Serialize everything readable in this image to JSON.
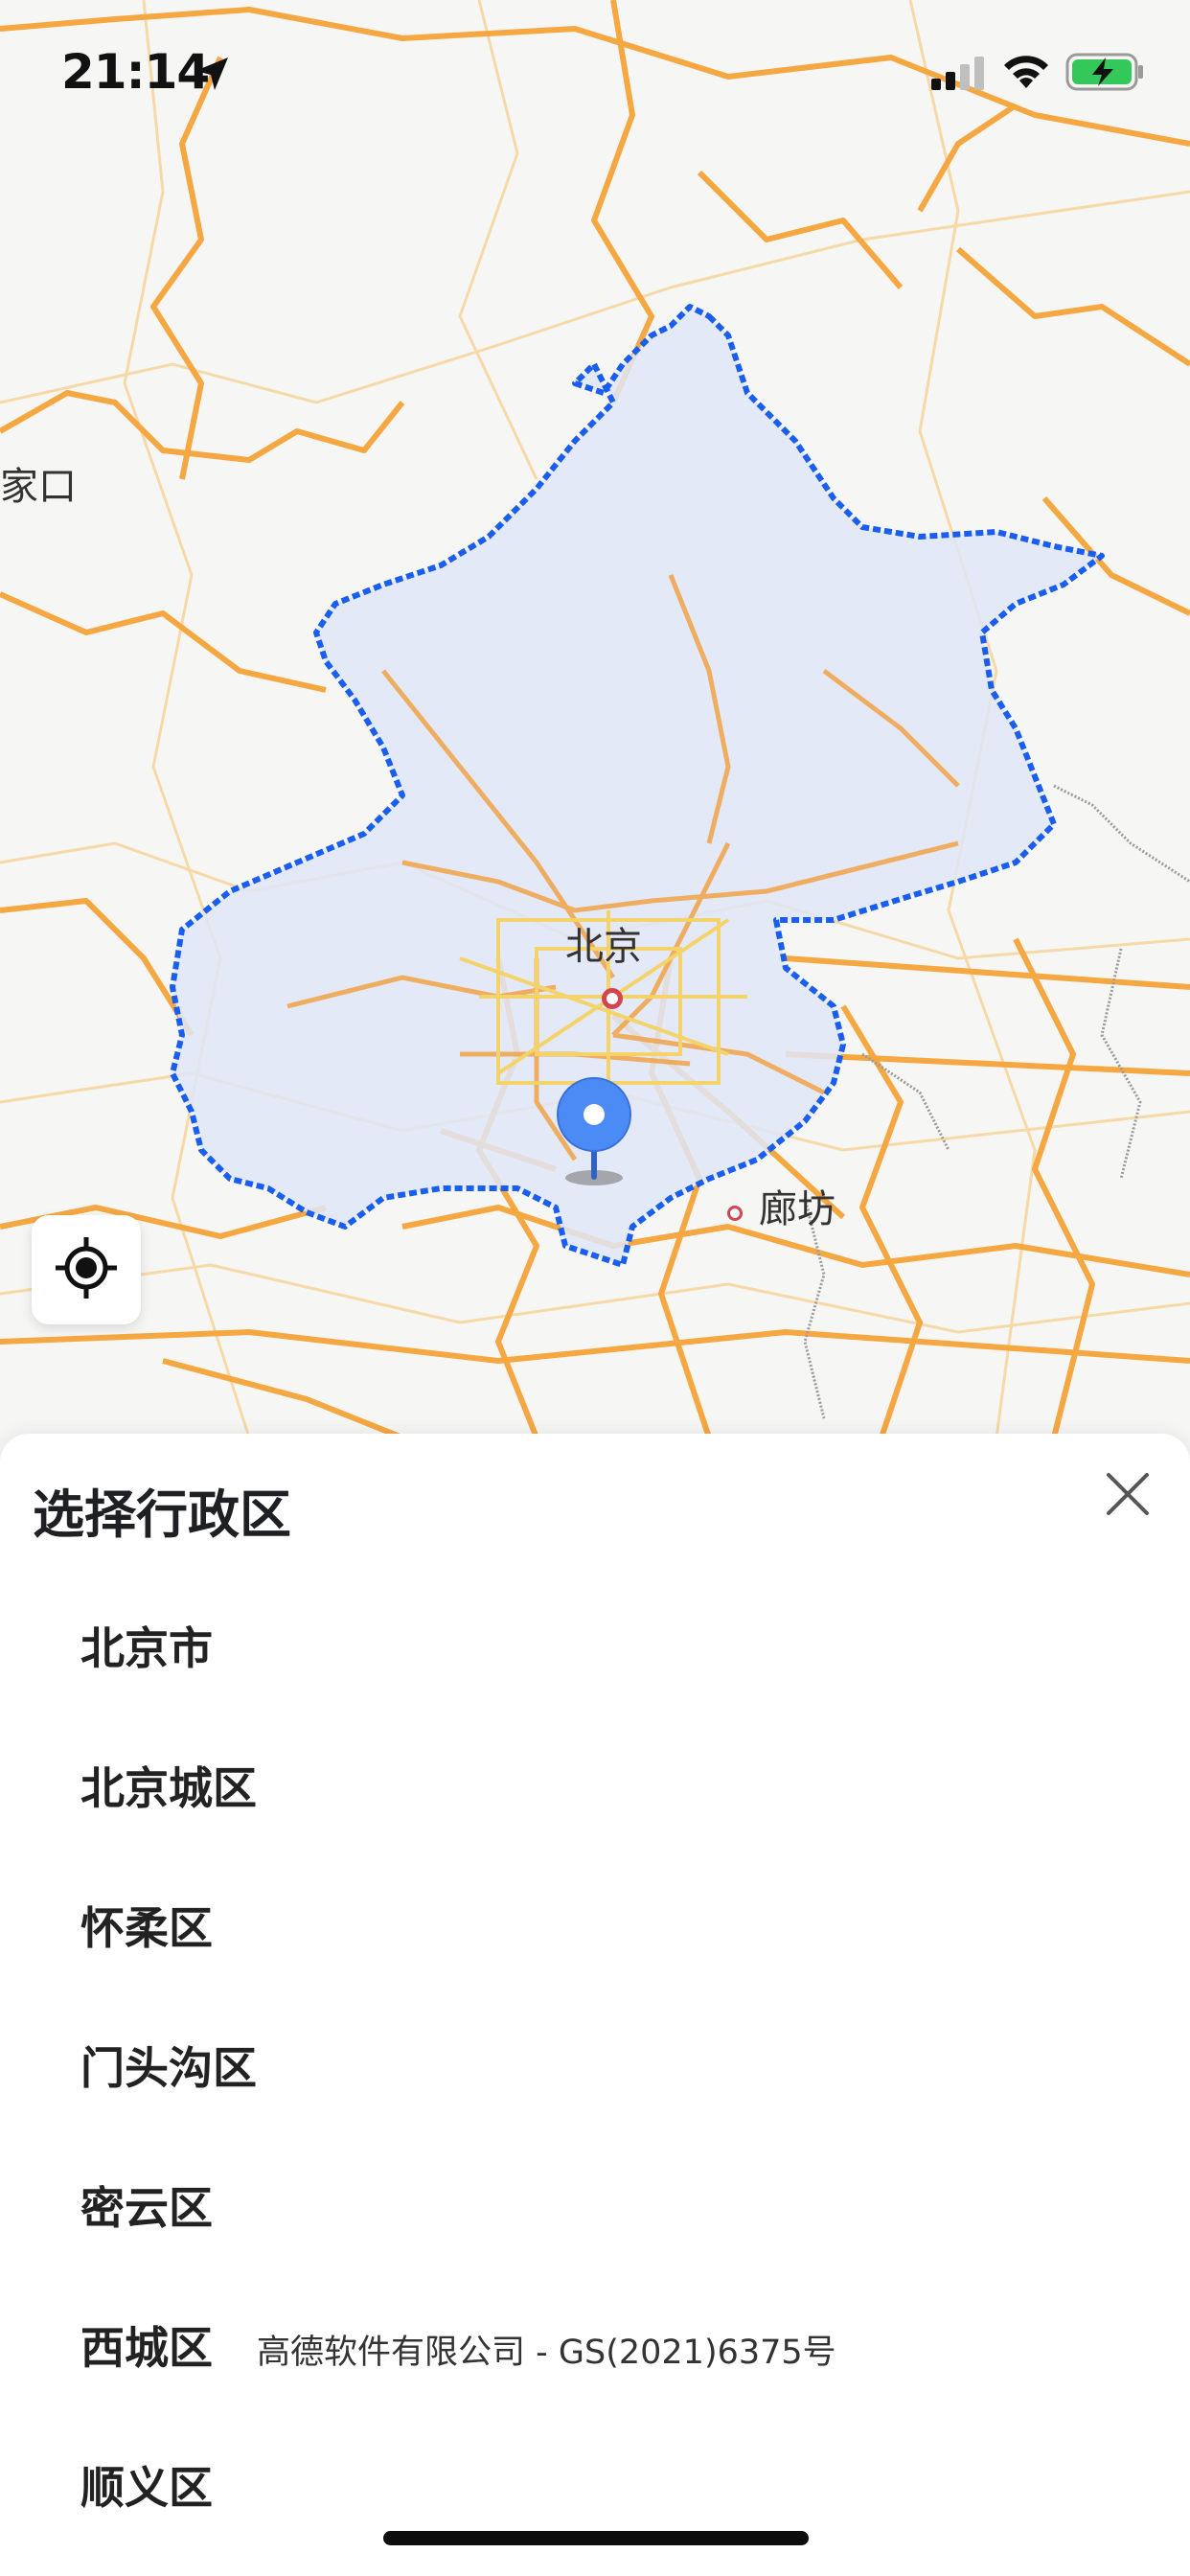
{
  "status_bar": {
    "time": "21:14",
    "icons": [
      "location-arrow-icon",
      "cellular-signal-icon",
      "wifi-icon",
      "battery-charging-icon"
    ]
  },
  "map": {
    "labels": {
      "zhangjiakou_partial": "家口",
      "beijing": "北京",
      "langfang": "廊坊"
    },
    "colors": {
      "region_fill": "#dfe6f6",
      "region_border": "#1a5ef0",
      "roads": "#f5a742",
      "pin": "#4b8bf5"
    }
  },
  "sheet": {
    "title": "选择行政区",
    "close_icon": "close-icon",
    "districts": [
      {
        "label": "北京市"
      },
      {
        "label": "北京城区"
      },
      {
        "label": "怀柔区"
      },
      {
        "label": "门头沟区"
      },
      {
        "label": "密云区"
      },
      {
        "label": "西城区"
      },
      {
        "label": "顺义区"
      }
    ],
    "copyright": "高德软件有限公司 - GS(2021)6375号"
  }
}
